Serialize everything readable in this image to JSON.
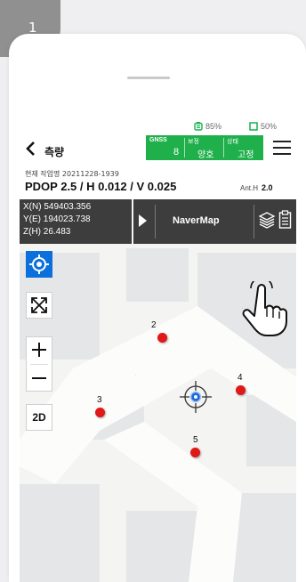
{
  "step": {
    "number": "1"
  },
  "status": {
    "battery_receiver": "85%",
    "battery_phone": "50%"
  },
  "header": {
    "back_label": "측량"
  },
  "gnss": {
    "label": "GNSS",
    "value": "8",
    "correction_label": "보정",
    "correction_value": "양호",
    "state_label": "상태",
    "state_value": "고정"
  },
  "info": {
    "job_name": "현재 작업명 20211228-1939",
    "dop": "PDOP 2.5 / H 0.012 / V 0.025",
    "ant_label": "Ant.H",
    "ant_value": "2.0"
  },
  "coords": {
    "x": "X(N) 549403.356",
    "y": "Y(E) 194023.738",
    "z": "Z(H) 26.483"
  },
  "toolbar": {
    "map_label": "NaverMap"
  },
  "map_controls": {
    "view_mode": "2D"
  },
  "points": [
    "2",
    "3",
    "4",
    "5"
  ],
  "colors": {
    "gnss_green": "#1fb04b",
    "toolbar_bg": "#3d3d3d",
    "point_red": "#e01818",
    "locate_blue": "#0b6fdc"
  },
  "icons": [
    "chevron-left-icon",
    "hamburger-menu-icon",
    "play-arrow-icon",
    "layers-icon",
    "clipboard-icon",
    "locate-icon",
    "expand-arrows-icon",
    "plus-icon",
    "minus-icon",
    "crosshair-icon",
    "tap-hand-icon"
  ]
}
